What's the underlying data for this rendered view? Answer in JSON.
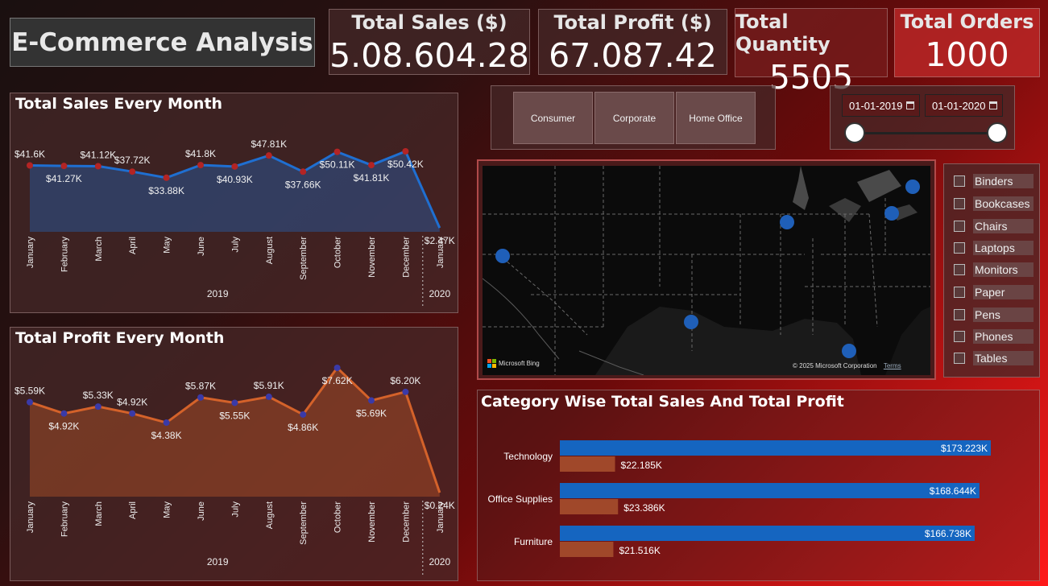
{
  "app_title": "E-Commerce Analysis",
  "kpis": [
    {
      "label": "Total Sales ($)",
      "value": "5.08.604.28"
    },
    {
      "label": "Total Profit ($)",
      "value": "67.087.42"
    },
    {
      "label": "Total Quantity",
      "value": "5505"
    },
    {
      "label": "Total Orders",
      "value": "1000"
    }
  ],
  "segments": [
    "Consumer",
    "Corporate",
    "Home Office"
  ],
  "date_range": {
    "start": "01-01-2019",
    "end": "01-01-2020"
  },
  "categories_filter": [
    "Binders",
    "Bookcases",
    "Chairs",
    "Laptops",
    "Monitors",
    "Paper",
    "Pens",
    "Phones",
    "Tables"
  ],
  "map": {
    "attribution": "Microsoft Bing",
    "copyright": "© 2025 Microsoft Corporation",
    "terms": "Terms",
    "locations_count": 7
  },
  "chart_data": [
    {
      "type": "area",
      "title": "Total Sales Every Month",
      "categories": [
        "January",
        "February",
        "March",
        "April",
        "May",
        "June",
        "July",
        "August",
        "September",
        "October",
        "November",
        "December",
        "January"
      ],
      "groups": [
        {
          "name": "2019"
        },
        {
          "name": "2020"
        }
      ],
      "values": [
        41.6,
        41.27,
        41.12,
        37.72,
        33.88,
        41.8,
        40.93,
        47.81,
        37.66,
        50.11,
        41.81,
        50.42,
        2.47
      ],
      "labels": [
        "$41.6K",
        "$41.27K",
        "$41.12K",
        "$37.72K",
        "$33.88K",
        "$41.8K",
        "$40.93K",
        "$47.81K",
        "$37.66K",
        "$50.11K",
        "$41.81K",
        "$50.42K",
        "$2.47K"
      ],
      "unit": "K",
      "color": "#1f6fd1",
      "marker_color": "#b32424"
    },
    {
      "type": "area",
      "title": "Total Profit Every Month",
      "categories": [
        "January",
        "February",
        "March",
        "April",
        "May",
        "June",
        "July",
        "August",
        "September",
        "October",
        "November",
        "December",
        "January"
      ],
      "groups": [
        {
          "name": "2019"
        },
        {
          "name": "2020"
        }
      ],
      "values": [
        5.59,
        4.92,
        5.33,
        4.92,
        4.38,
        5.87,
        5.55,
        5.91,
        4.86,
        7.62,
        5.69,
        6.2,
        0.24
      ],
      "labels": [
        "$5.59K",
        "$4.92K",
        "$5.33K",
        "$4.92K",
        "$4.38K",
        "$5.87K",
        "$5.55K",
        "$5.91K",
        "$4.86K",
        "$7.62K",
        "$5.69K",
        "$6.20K",
        "$0.24K"
      ],
      "unit": "K",
      "color": "#d4622a",
      "marker_color": "#3a3aa8"
    },
    {
      "type": "bar",
      "orientation": "horizontal",
      "title": "Category Wise Total Sales And Total Profit",
      "categories": [
        "Technology",
        "Office Supplies",
        "Furniture"
      ],
      "series": [
        {
          "values": [
            173.223,
            168.644,
            166.738
          ],
          "labels": [
            "$173.223K",
            "$168.644K",
            "$166.738K"
          ],
          "color": "#1565c0"
        },
        {
          "values": [
            22.185,
            23.386,
            21.516
          ],
          "labels": [
            "$22.185K",
            "$23.386K",
            "$21.516K"
          ],
          "color": "#a0482a"
        }
      ]
    }
  ]
}
